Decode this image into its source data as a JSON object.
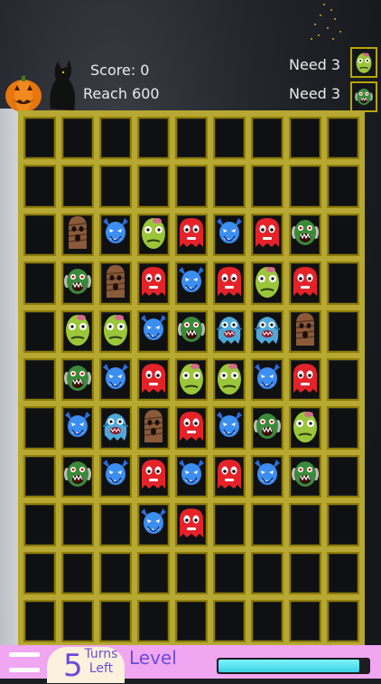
{
  "hud": {
    "score_text": "Score: 0",
    "reach_text": "Reach 600",
    "goals": [
      {
        "text": "Need 3",
        "monster": "zombie-head"
      },
      {
        "text": "Need 3",
        "monster": "ogre"
      }
    ]
  },
  "board": {
    "rows": 11,
    "cols": 9,
    "cells": [
      [
        "",
        "",
        "",
        "",
        "",
        "",
        "",
        "",
        ""
      ],
      [
        "",
        "",
        "",
        "",
        "",
        "",
        "",
        "",
        ""
      ],
      [
        "",
        "mummy",
        "blue-imp",
        "zombie-head",
        "red-ghost",
        "blue-imp",
        "red-ghost",
        "ogre",
        ""
      ],
      [
        "",
        "ogre",
        "mummy",
        "red-ghost",
        "blue-imp",
        "red-ghost",
        "zombie-head",
        "red-ghost",
        ""
      ],
      [
        "",
        "zombie-head",
        "zombie-head",
        "blue-imp",
        "ogre",
        "cyan-creature",
        "cyan-creature",
        "mummy",
        ""
      ],
      [
        "",
        "ogre",
        "blue-imp",
        "red-ghost",
        "zombie-head",
        "zombie-head",
        "blue-imp",
        "red-ghost",
        ""
      ],
      [
        "",
        "blue-imp",
        "cyan-creature",
        "mummy",
        "red-ghost",
        "blue-imp",
        "ogre",
        "zombie-head",
        ""
      ],
      [
        "",
        "ogre",
        "blue-imp",
        "red-ghost",
        "blue-imp",
        "red-ghost",
        "blue-imp",
        "ogre",
        ""
      ],
      [
        "",
        "",
        "",
        "blue-imp",
        "red-ghost",
        "",
        "",
        "",
        ""
      ],
      [
        "",
        "",
        "",
        "",
        "",
        "",
        "",
        "",
        ""
      ],
      [
        "",
        "",
        "",
        "",
        "",
        "",
        "",
        "",
        ""
      ]
    ]
  },
  "bottom": {
    "turns_number": "5",
    "turns_label": "Turns Left",
    "level_label": "Level",
    "level_progress": 0.94
  },
  "colors": {
    "board_frame": "#b6a832",
    "cell_border": "#8f7d06",
    "bottom_bar": "#f0a6f0",
    "accent_text": "#6a4cd8",
    "progress": "#56e1f0"
  }
}
